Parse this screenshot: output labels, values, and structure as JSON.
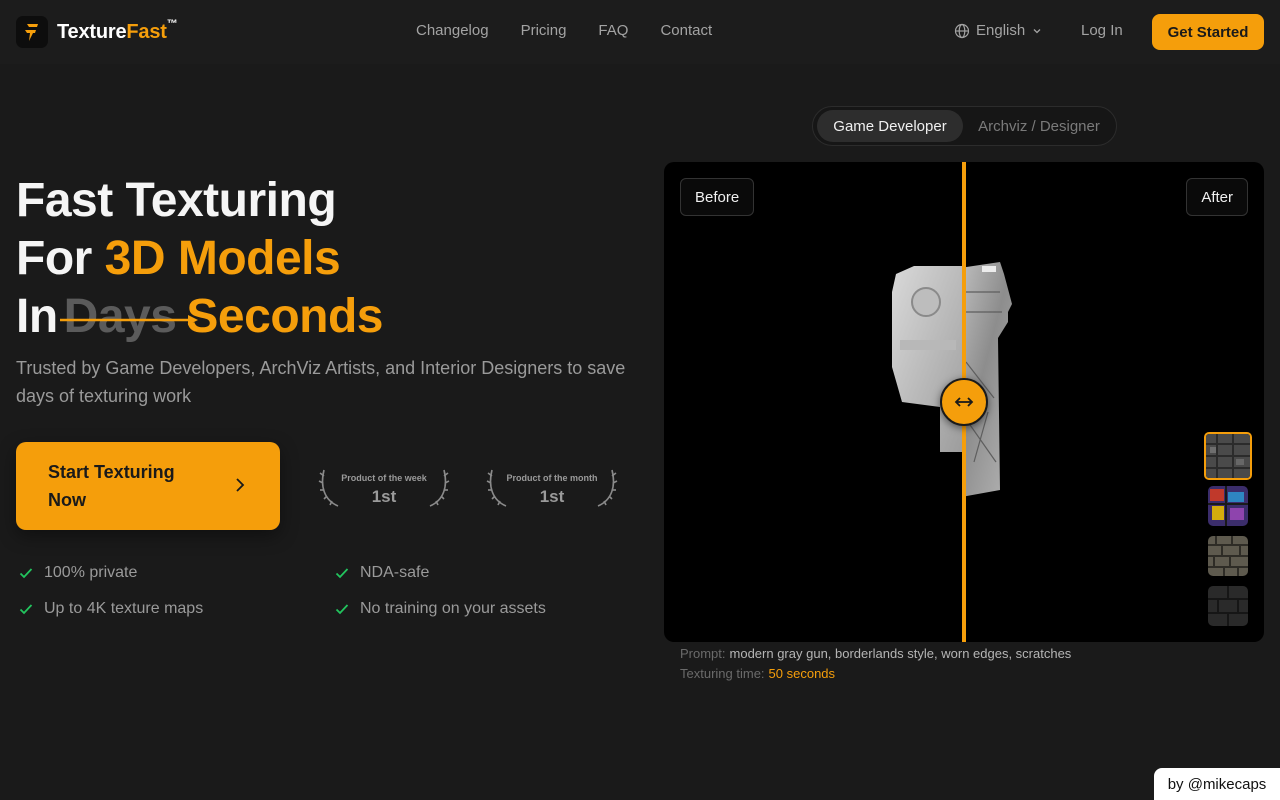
{
  "brand": {
    "name_main": "Texture",
    "name_accent": "Fast",
    "tm": "™"
  },
  "nav": {
    "links": [
      "Changelog",
      "Pricing",
      "FAQ",
      "Contact"
    ],
    "language": "English",
    "login": "Log In",
    "cta": "Get Started"
  },
  "hero": {
    "line1": "Fast Texturing",
    "line2_pre": "For ",
    "line2_accent": "3D Models",
    "line3_pre": "In",
    "line3_struck": "Days",
    "line3_accent": "Seconds",
    "subtitle": "Trusted by Game Developers, ArchViz Artists, and Interior Designers to save days of texturing work",
    "cta": "Start Texturing Now"
  },
  "awards": [
    {
      "label": "Product of the week",
      "rank": "1st"
    },
    {
      "label": "Product of the month",
      "rank": "1st"
    }
  ],
  "features": [
    "100% private",
    "NDA-safe",
    "Up to 4K texture maps",
    "No training on your assets"
  ],
  "segment": {
    "options": [
      "Game Developer",
      "Archviz / Designer"
    ],
    "selected": "Game Developer"
  },
  "viewer": {
    "before_label": "Before",
    "after_label": "After",
    "prompt_label": "Prompt:",
    "prompt_value": "modern gray gun, borderlands style, worn edges, scratches",
    "time_label": "Texturing time:",
    "time_value": "50 seconds",
    "slider_position": 0.5,
    "accent_color": "#f59e0b"
  },
  "credit": "by @mikecaps"
}
